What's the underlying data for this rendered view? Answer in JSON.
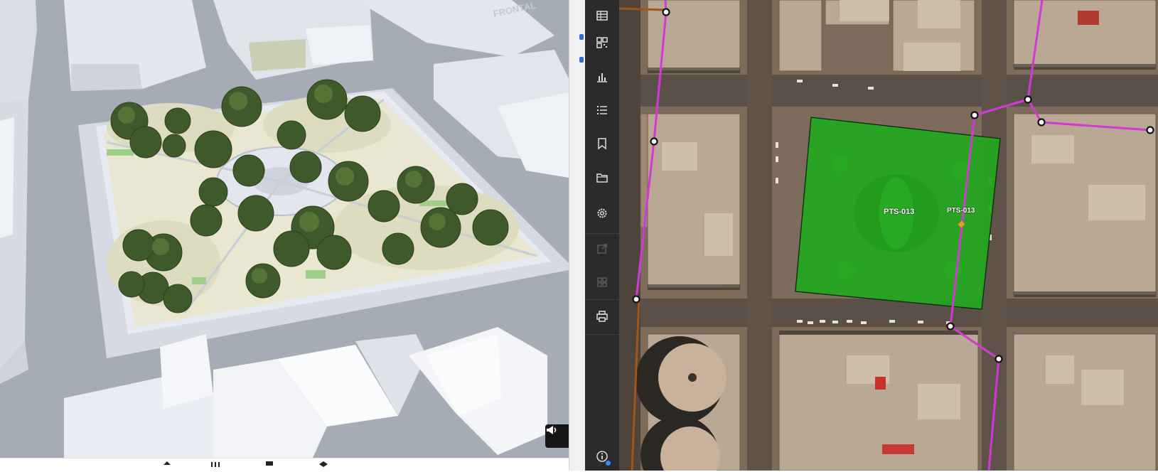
{
  "scene3d": {
    "watermark_text": "FRONTAL",
    "announce_button": {
      "icon": "megaphone-icon"
    },
    "bottom_strip_icons": [
      "layer-icon",
      "measure-icon",
      "flag-icon",
      "stack-icon"
    ]
  },
  "toolbar": {
    "buttons": [
      {
        "icon": "table-icon",
        "enabled": true
      },
      {
        "icon": "qr-grid-icon",
        "enabled": true
      },
      {
        "icon": "bar-chart-icon",
        "enabled": true
      },
      {
        "icon": "list-icon",
        "enabled": true
      },
      {
        "icon": "bookmark-icon",
        "enabled": true
      },
      {
        "icon": "folder-icon",
        "enabled": true
      },
      {
        "icon": "gear-icon",
        "enabled": true
      },
      {
        "icon": "export-icon",
        "enabled": false
      },
      {
        "icon": "grid-icon",
        "enabled": false
      },
      {
        "icon": "print-icon",
        "enabled": true
      }
    ],
    "bottom_button": {
      "icon": "info-icon"
    }
  },
  "map": {
    "plot_label_1": "PTS-013",
    "plot_label_2": "PTS-013",
    "colors": {
      "parcel_fill": "#22a81f",
      "route_line": "#d23ad6",
      "secondary_line": "#a0561a",
      "marker_point": "#f29b24"
    }
  }
}
